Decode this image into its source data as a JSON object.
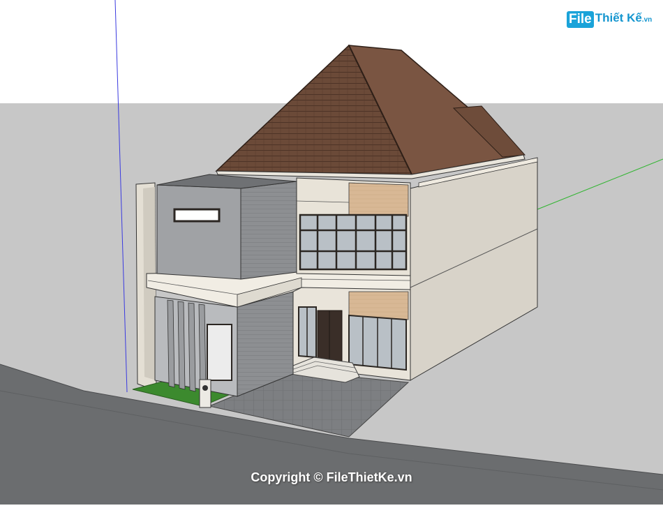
{
  "watermark": {
    "logo_file": "File",
    "logo_rest": "Thiết Kế",
    "logo_domain": ".vn",
    "copyright": "Copyright © FileThietKe.vn"
  },
  "colors": {
    "ground": "#c7c7c7",
    "road": "#6b6d6f",
    "roof": "#6b4a38",
    "wall_light": "#e8e3d8",
    "wall_side": "#cfcbc2",
    "cladding_gray": "#8d8f92",
    "wood_panel": "#d8b895",
    "window_frame": "#2b2622",
    "glass": "#b9c0c6",
    "lawn": "#3c8a2e",
    "paving": "#7d7f82"
  }
}
